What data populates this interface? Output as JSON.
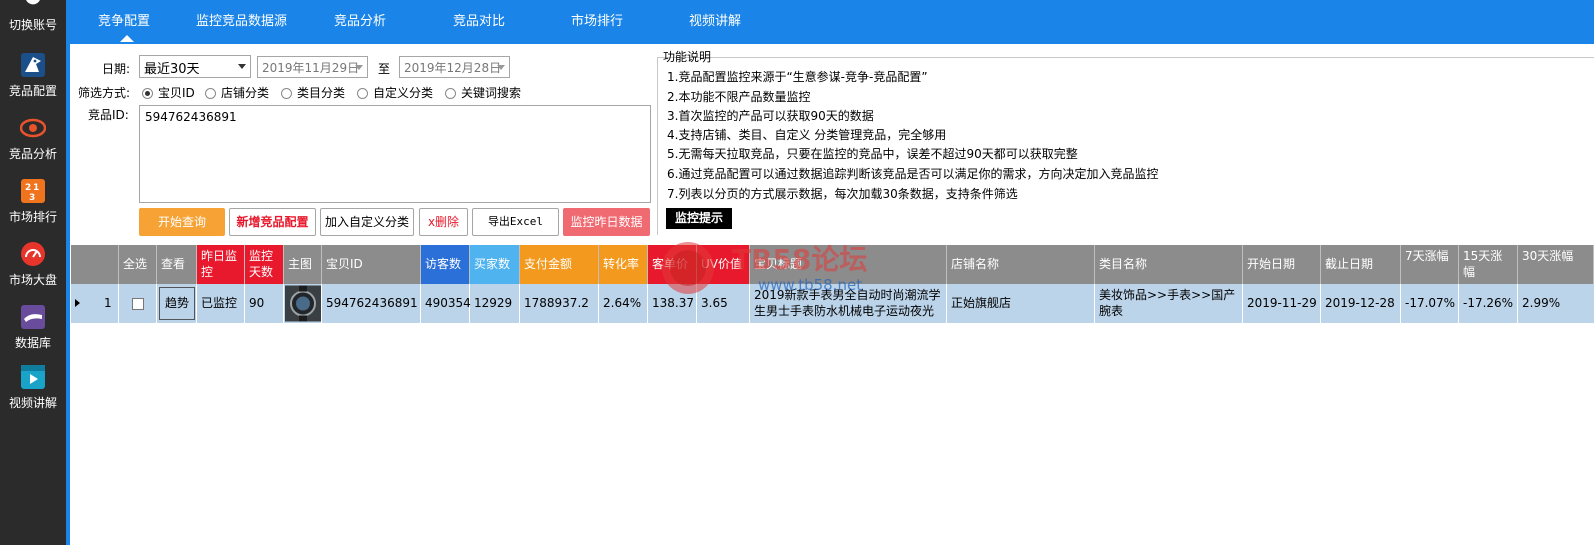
{
  "sidebar": {
    "items": [
      {
        "label": "切换账号",
        "icon": "switch-account-icon"
      },
      {
        "label": "竞品配置",
        "icon": "eagle-icon"
      },
      {
        "label": "竞品分析",
        "icon": "eye-icon"
      },
      {
        "label": "市场排行",
        "icon": "ranking-icon"
      },
      {
        "label": "市场大盘",
        "icon": "dashboard-gauge-icon"
      },
      {
        "label": "数据库",
        "icon": "database-hand-icon"
      },
      {
        "label": "视频讲解",
        "icon": "video-icon"
      }
    ]
  },
  "tabs": [
    {
      "label": "竞争配置",
      "active": true
    },
    {
      "label": "监控竞品数据源",
      "active": false
    },
    {
      "label": "竞品分析",
      "active": false
    },
    {
      "label": "竞品对比",
      "active": false
    },
    {
      "label": "市场排行",
      "active": false
    },
    {
      "label": "视频讲解",
      "active": false
    }
  ],
  "form": {
    "date_label": "日期:",
    "range_value": "最近30天",
    "start_date": "2019年11月29日",
    "to_label": "至",
    "end_date": "2019年12月28日",
    "filter_label": "筛选方式:",
    "filter_options": [
      "宝贝ID",
      "店铺分类",
      "类目分类",
      "自定义分类",
      "关键词搜索"
    ],
    "filter_selected": "宝贝ID",
    "id_label": "竞品ID:",
    "id_value": "594762436891"
  },
  "buttons": {
    "query": "开始查询",
    "add_config": "新增竞品配置",
    "add_custom": "加入自定义分类",
    "delete": "x删除",
    "export": "导出Excel",
    "monitor_yesterday": "监控昨日数据"
  },
  "info": {
    "title": "功能说明",
    "lines": [
      "1.竞品配置监控来源于“生意参谋-竞争-竞品配置”",
      "2.本功能不限产品数量监控",
      "3.首次监控的产品可以获取90天的数据",
      "4.支持店铺、类目、自定义 分类管理竞品，完全够用",
      "5.无需每天拉取竞品，只要在监控的竞品中，误差不超过90天都可以获取完整",
      "6.通过竞品配置可以通过数据追踪判断该竞品是否可以满足你的需求，方向决定加入竞品监控",
      "7.列表以分页的方式展示数据，每次加载30条数据，支持条件筛选"
    ],
    "tip": "监控提示"
  },
  "table": {
    "headers": {
      "select_all": "全选",
      "view": "查看",
      "yesterday_monitor": "昨日监控",
      "monitor_days": "监控天数",
      "main_image": "主图",
      "item_id": "宝贝ID",
      "visitors": "访客数",
      "buyers": "买家数",
      "payment": "支付金额",
      "conversion": "转化率",
      "unit_price": "客单价",
      "uv_value": "UV价值",
      "item_title": "宝贝标题",
      "shop_name": "店铺名称",
      "category": "类目名称",
      "start_date": "开始日期",
      "end_date": "截止日期",
      "change_7": "7天涨幅",
      "change_15": "15天涨幅",
      "change_30": "30天涨幅"
    },
    "header_colors": {
      "yesterday_monitor": "#e8192c",
      "monitor_days": "#e8192c",
      "visitors": "#2b6fd8",
      "buyers": "#4fb3f0",
      "payment": "#f39a1e",
      "conversion": "#f39a1e",
      "unit_price": "#e8192c",
      "uv_value": "#e8192c"
    },
    "rows": [
      {
        "index": "1",
        "view": "趋势",
        "yesterday_monitor": "已监控",
        "monitor_days": "90",
        "item_id": "594762436891",
        "visitors": "490354",
        "buyers": "12929",
        "payment": "1788937.2",
        "conversion": "2.64%",
        "unit_price": "138.37",
        "uv_value": "3.65",
        "item_title": "2019新款手表男全自动时尚潮流学生男士手表防水机械电子运动夜光",
        "shop_name": "正始旗舰店",
        "category": "美妆饰品>>手表>>国产腕表",
        "start_date": "2019-11-29",
        "end_date": "2019-12-28",
        "change_7": "-17.07%",
        "change_15": "-17.26%",
        "change_30": "2.99%"
      }
    ]
  },
  "watermark": {
    "title": "TB58论坛",
    "url": "www.tb58.net"
  }
}
